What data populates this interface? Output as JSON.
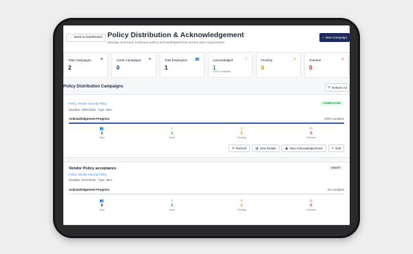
{
  "header": {
    "back_label": "Back to Dashboard",
    "title": "Policy Distribution & Acknowledgement",
    "subtitle": "Manage and track employee policy acknowledgements across your organization",
    "new_campaign_label": "New Campaign"
  },
  "stats": [
    {
      "label": "Total Campaigns",
      "value": "2",
      "note": "",
      "icon": "send-icon",
      "glyph": "➤",
      "color": "#111827"
    },
    {
      "label": "Active Campaigns",
      "value": "0",
      "note": "",
      "icon": "send-icon",
      "glyph": "➤",
      "color": "#1e3a8a"
    },
    {
      "label": "Total Employees",
      "value": "1",
      "note": "",
      "icon": "users-icon",
      "glyph": "👥",
      "color": "#111827"
    },
    {
      "label": "Acknowledged",
      "value": "1",
      "note": "100% complete",
      "icon": "check-circle-icon",
      "glyph": "✓",
      "color": "#16a34a"
    },
    {
      "label": "Pending",
      "value": "0",
      "note": "",
      "icon": "clock-icon",
      "glyph": "◷",
      "color": "#ea8a0b"
    },
    {
      "label": "Overdue",
      "value": "0",
      "note": "",
      "icon": "alert-triangle-icon",
      "glyph": "⚠",
      "color": "#dc2626"
    }
  ],
  "section": {
    "title": "Policy Distribution Campaigns",
    "refresh_all_label": "Refresh All"
  },
  "campaigns": [
    {
      "title": "",
      "policy": "Policy: Vendor Security Policy",
      "meta": "Deadline: 30/07/2025 · Type: other",
      "badge": "COMPLETED",
      "badge_color": "#15803d",
      "badge_bg": "#dcfce7",
      "progress_label": "Acknowledgement Progress",
      "progress_text": "100% complete",
      "progress": 1.0,
      "metrics": [
        {
          "label": "Total",
          "value": "1"
        },
        {
          "label": "Done",
          "value": "1"
        },
        {
          "label": "Pending",
          "value": "0"
        },
        {
          "label": "Overdue",
          "value": "0"
        }
      ],
      "actions": [
        "Refresh",
        "View Details",
        "View Acknowledgements",
        "Edit"
      ]
    },
    {
      "title": "Vendor Policy acceptance",
      "policy": "Policy: Vendor Security Policy",
      "meta": "Deadline: 01/07/2025 · Type: other",
      "badge": "DRAFT",
      "badge_color": "#374151",
      "badge_bg": "#f3f4f6",
      "progress_label": "Acknowledgement Progress",
      "progress_text": "0% complete",
      "progress": 0.0,
      "metrics": [
        {
          "label": "Total",
          "value": "0"
        },
        {
          "label": "Done",
          "value": "0"
        },
        {
          "label": "Pending",
          "value": "0"
        },
        {
          "label": "Overdue",
          "value": "0"
        }
      ]
    }
  ]
}
